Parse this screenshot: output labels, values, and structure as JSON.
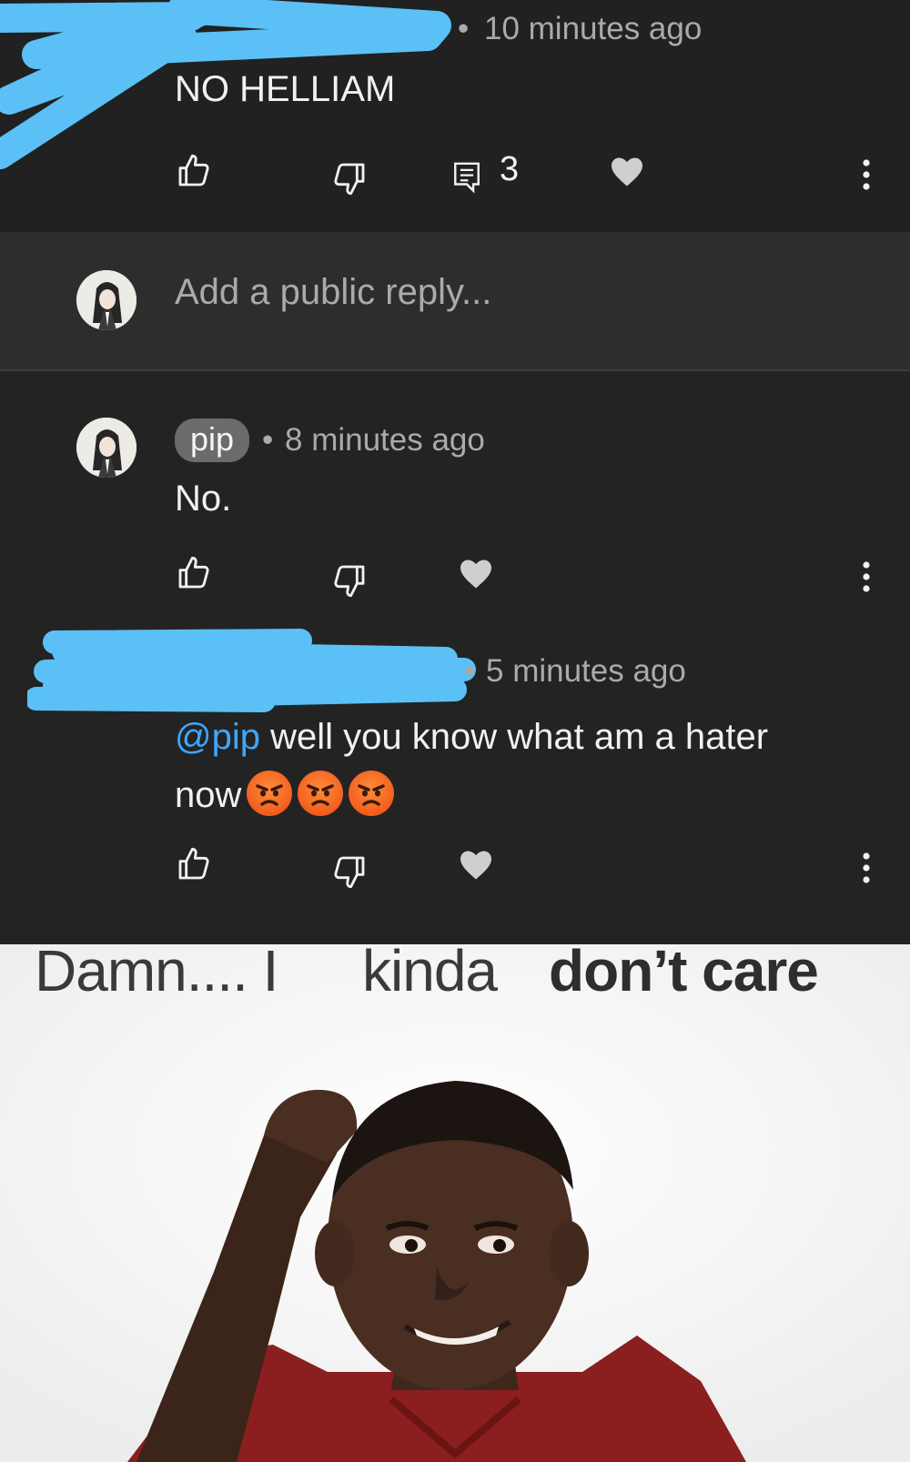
{
  "comment_top": {
    "timestamp": "10 minutes ago",
    "text": "NO HELLIAM",
    "reply_count": "3",
    "icons": [
      "like-icon",
      "dislike-icon",
      "reply-icon",
      "heart-icon",
      "more-vert-icon"
    ]
  },
  "reply_box": {
    "placeholder": "Add a public reply..."
  },
  "reply_pip": {
    "author": "pip",
    "timestamp": "8 minutes ago",
    "text": "No.",
    "icons": [
      "like-icon",
      "dislike-icon",
      "heart-icon",
      "more-vert-icon"
    ]
  },
  "reply_second": {
    "timestamp": "5 minutes ago",
    "mention": "@pip",
    "text_line1": " well you know what am a hater",
    "text_line2": "now",
    "emoji_count": 3,
    "emoji": "angry-face-icon",
    "icons": [
      "like-icon",
      "dislike-icon",
      "heart-icon",
      "more-vert-icon"
    ]
  },
  "meme": {
    "word1": "Damn.... I",
    "word2": "kinda",
    "word3": "don’t care"
  },
  "colors": {
    "background_top": "#212121",
    "reply_box_bg": "#2d2d2d",
    "thread_bg": "#232323",
    "mention": "#3ea6ff",
    "redaction": "#5bc0f5",
    "meme_bg": "#f7f7f7"
  }
}
